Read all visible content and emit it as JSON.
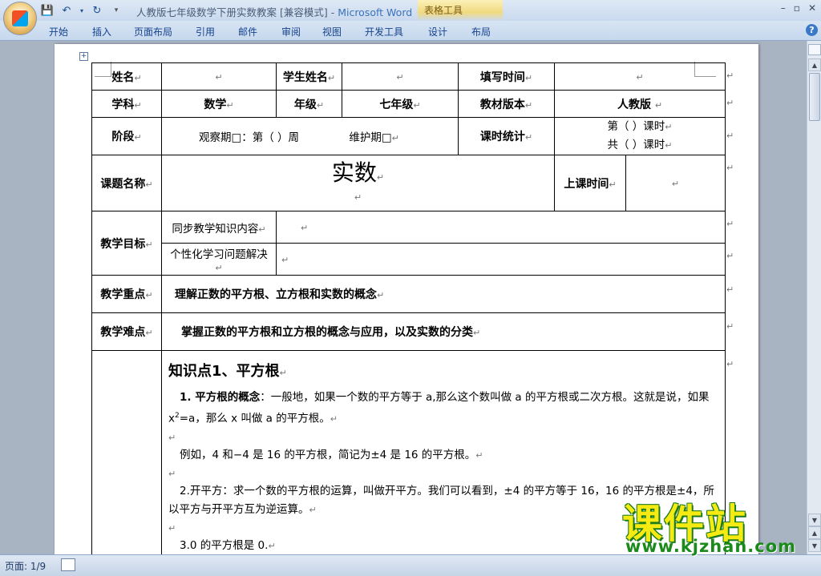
{
  "window": {
    "title": "人教版七年级数学下册实数教案 [兼容模式] - ",
    "app_name": "Microsoft Word",
    "context_tab_group": "表格工具",
    "controls": [
      "–",
      "▫",
      "✕"
    ]
  },
  "ribbon": {
    "tabs": [
      "开始",
      "插入",
      "页面布局",
      "引用",
      "邮件",
      "审阅",
      "视图",
      "开发工具",
      "设计",
      "布局"
    ],
    "help": "?"
  },
  "para_mark": "↵",
  "table": {
    "name_label": "姓名",
    "student_name_label": "学生姓名",
    "fill_time_label": "填写时间",
    "subject_label": "学科",
    "subject_value": "数学",
    "grade_label": "年级",
    "grade_value": "七年级",
    "textbook_label": "教材版本",
    "textbook_value": "人教版",
    "stage_label": "阶段",
    "stage_observe": "观察期□：第（    ）周",
    "stage_maintain": "维护期□",
    "lesson_count_label": "课时统计",
    "lesson_count_1": "第（    ）课时",
    "lesson_count_2": "共（    ）课时",
    "topic_label": "课题名称",
    "topic_value": "实数",
    "class_time_label": "上课时间",
    "goal_label": "教学目标",
    "goal_sub1": "同步教学知识内容",
    "goal_sub2": "个性化学习问题解决",
    "key_label": "教学重点",
    "key_value": "理解正数的平方根、立方根和实数的概念",
    "difficulty_label": "教学难点",
    "difficulty_value": "掌握正数的平方根和立方根的概念与应用，以及实数的分类"
  },
  "content": {
    "kp1_title": "知识点1、平方根",
    "p1_bold": "1. 平方根的概念",
    "p1_text_a": "：一般地，如果一个数的平方等于 a,那么这个数叫做 a 的平方根或二次方根。这就是说，如果 x",
    "p1_sup": "2",
    "p1_text_b": "=a，那么 x 叫做 a 的平方根。",
    "p2": "例如，4 和−4 是 16 的平方根，简记为±4 是 16 的平方根。",
    "p3": "2.开平方：求一个数的平方根的运算，叫做开平方。我们可以看到，±4 的平方等于 16，16 的平方根是±4，所以平方与开平方互为逆运算。",
    "p4": "3.0 的平方根是 0."
  },
  "status": {
    "page": "页面: 1/9"
  },
  "watermark": {
    "big": "课件站",
    "url": "www.kjzhan.com"
  }
}
